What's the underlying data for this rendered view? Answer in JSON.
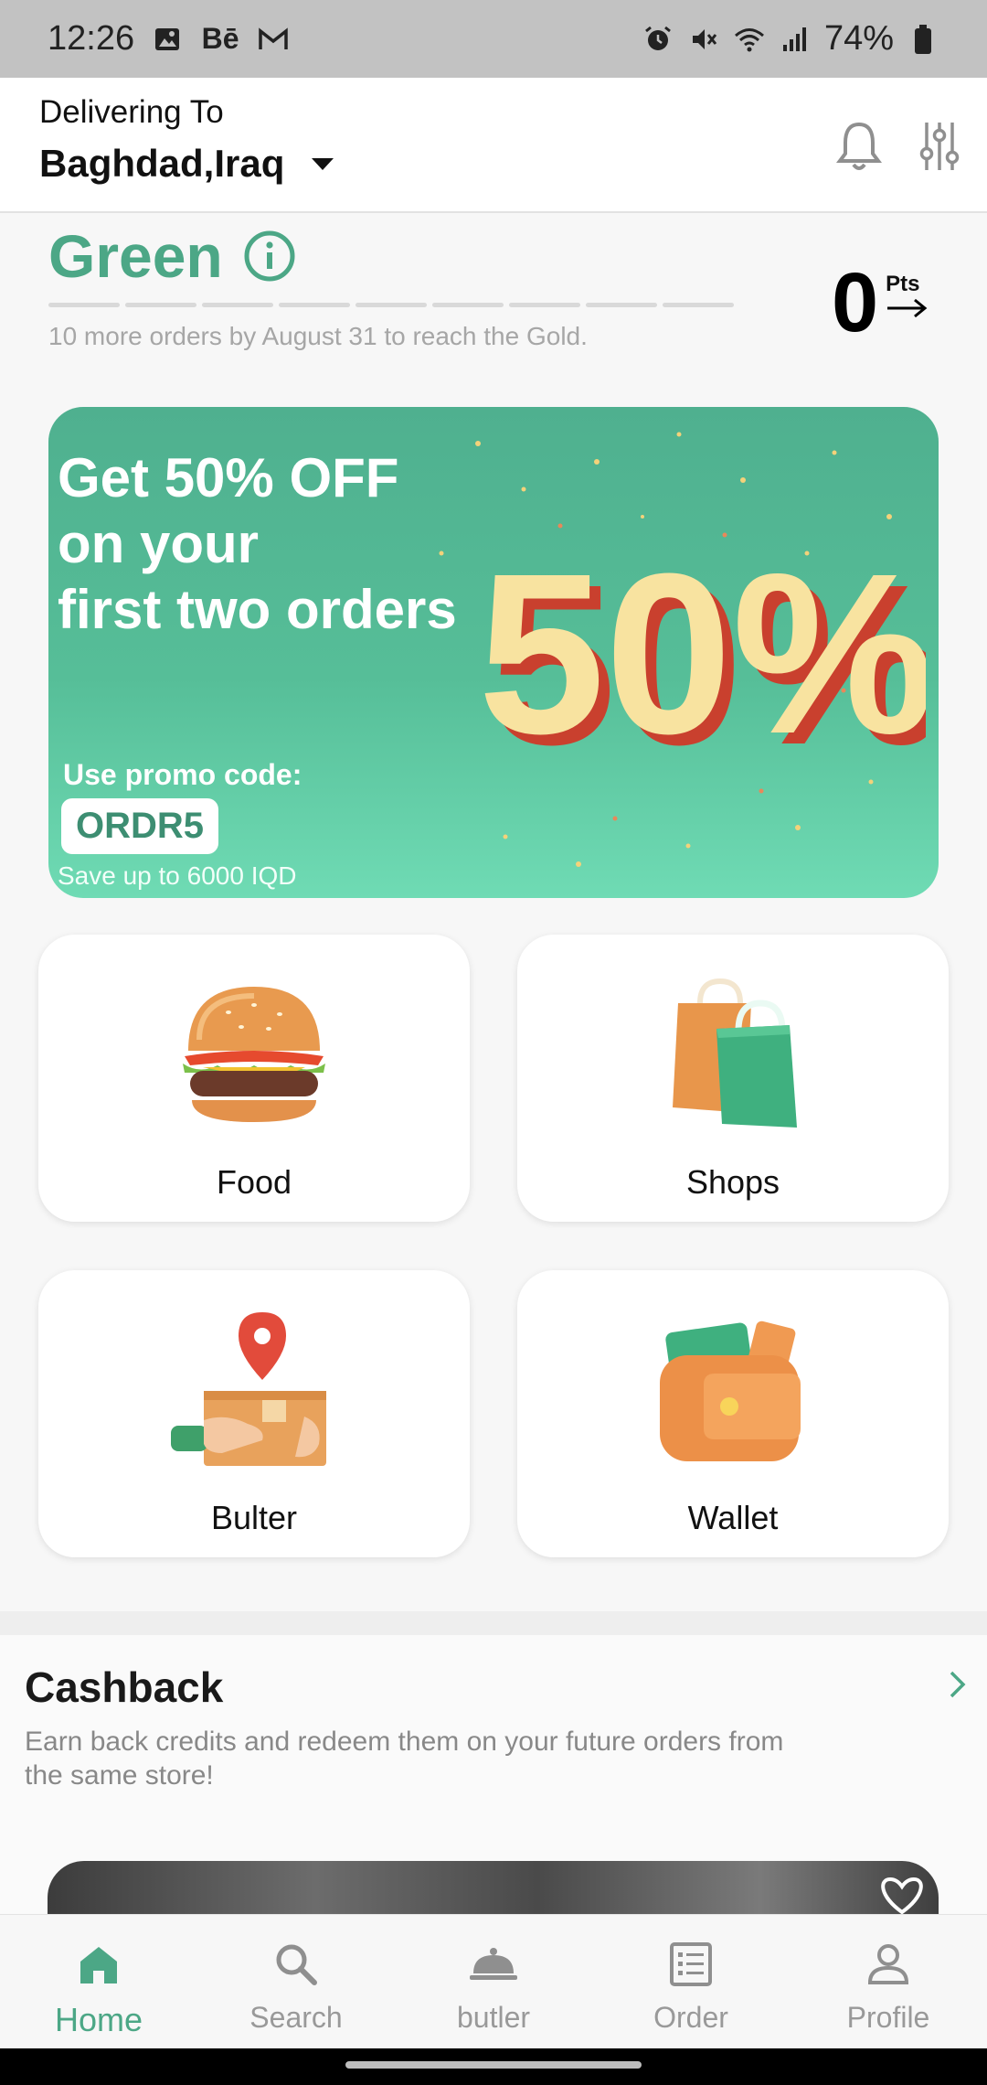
{
  "status_bar": {
    "time": "12:26",
    "left_icons": [
      "image-icon",
      "behance-icon",
      "gmail-icon"
    ],
    "right_icons": [
      "alarm-icon",
      "mute-icon",
      "wifi-icon",
      "signal-icon"
    ],
    "battery": "74%"
  },
  "header": {
    "delivering_label": "Delivering To",
    "location": "Baghdad,Iraq",
    "icons": [
      "bell-icon",
      "filter-sliders-icon"
    ]
  },
  "tier": {
    "name": "Green",
    "note": "10 more orders by August 31 to reach the Gold.",
    "progress_segments": 9,
    "progress_filled": 0,
    "points": "0",
    "points_label": "Pts"
  },
  "banner": {
    "headline": [
      "Get 50% OFF",
      "on your",
      "first two orders"
    ],
    "big_text": "50%",
    "promo_label": "Use promo code:",
    "promo_code": "ORDR5",
    "save_text": "Save up to 6000 IQD"
  },
  "categories": [
    {
      "label": "Food",
      "icon": "burger-icon"
    },
    {
      "label": "Shops",
      "icon": "shopping-bags-icon"
    },
    {
      "label": "Bulter",
      "icon": "delivery-box-icon"
    },
    {
      "label": "Wallet",
      "icon": "wallet-icon"
    }
  ],
  "cashback": {
    "title": "Cashback",
    "description": "Earn back credits and redeem them on your future orders from the same store!"
  },
  "bottom_nav": [
    {
      "label": "Home",
      "icon": "home-icon",
      "active": true
    },
    {
      "label": "Search",
      "icon": "search-icon",
      "active": false
    },
    {
      "label": "butler",
      "icon": "cloche-icon",
      "active": false
    },
    {
      "label": "Order",
      "icon": "order-list-icon",
      "active": false
    },
    {
      "label": "Profile",
      "icon": "profile-icon",
      "active": false
    }
  ],
  "colors": {
    "accent": "#4ca786",
    "banner_green": "#56be98",
    "muted_text": "#a6a6a6"
  }
}
